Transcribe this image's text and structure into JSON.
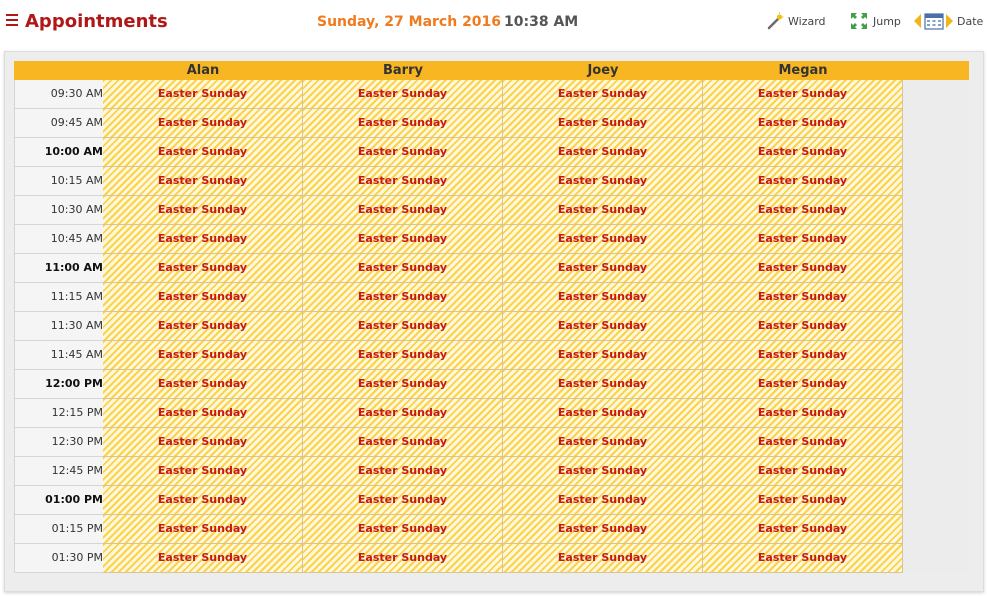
{
  "header": {
    "title": "Appointments",
    "date": "Sunday, 27 March 2016",
    "time": "10:38 AM"
  },
  "toolbar": {
    "wizard_label": "Wizard",
    "jump_label": "Jump",
    "date_label": "Date"
  },
  "icons": {
    "menu": "hamburger-menu-icon",
    "wizard": "magic-wand-icon",
    "jump": "expand-arrows-icon",
    "prev": "triangle-left-icon",
    "calendar": "calendar-icon",
    "next": "triangle-right-icon"
  },
  "colors": {
    "title": "#b01818",
    "date": "#f07a1e",
    "header_bar": "#f8b722",
    "event_text": "#c41a1a"
  },
  "columns": [
    "Alan",
    "Barry",
    "Joey",
    "Megan"
  ],
  "event_label": "Easter Sunday",
  "rows": [
    {
      "time": "09:30 AM",
      "hour": false
    },
    {
      "time": "09:45 AM",
      "hour": false
    },
    {
      "time": "10:00 AM",
      "hour": true
    },
    {
      "time": "10:15 AM",
      "hour": false
    },
    {
      "time": "10:30 AM",
      "hour": false
    },
    {
      "time": "10:45 AM",
      "hour": false
    },
    {
      "time": "11:00 AM",
      "hour": true
    },
    {
      "time": "11:15 AM",
      "hour": false
    },
    {
      "time": "11:30 AM",
      "hour": false
    },
    {
      "time": "11:45 AM",
      "hour": false
    },
    {
      "time": "12:00 PM",
      "hour": true
    },
    {
      "time": "12:15 PM",
      "hour": false
    },
    {
      "time": "12:30 PM",
      "hour": false
    },
    {
      "time": "12:45 PM",
      "hour": false
    },
    {
      "time": "01:00 PM",
      "hour": true
    },
    {
      "time": "01:15 PM",
      "hour": false
    },
    {
      "time": "01:30 PM",
      "hour": false
    }
  ]
}
